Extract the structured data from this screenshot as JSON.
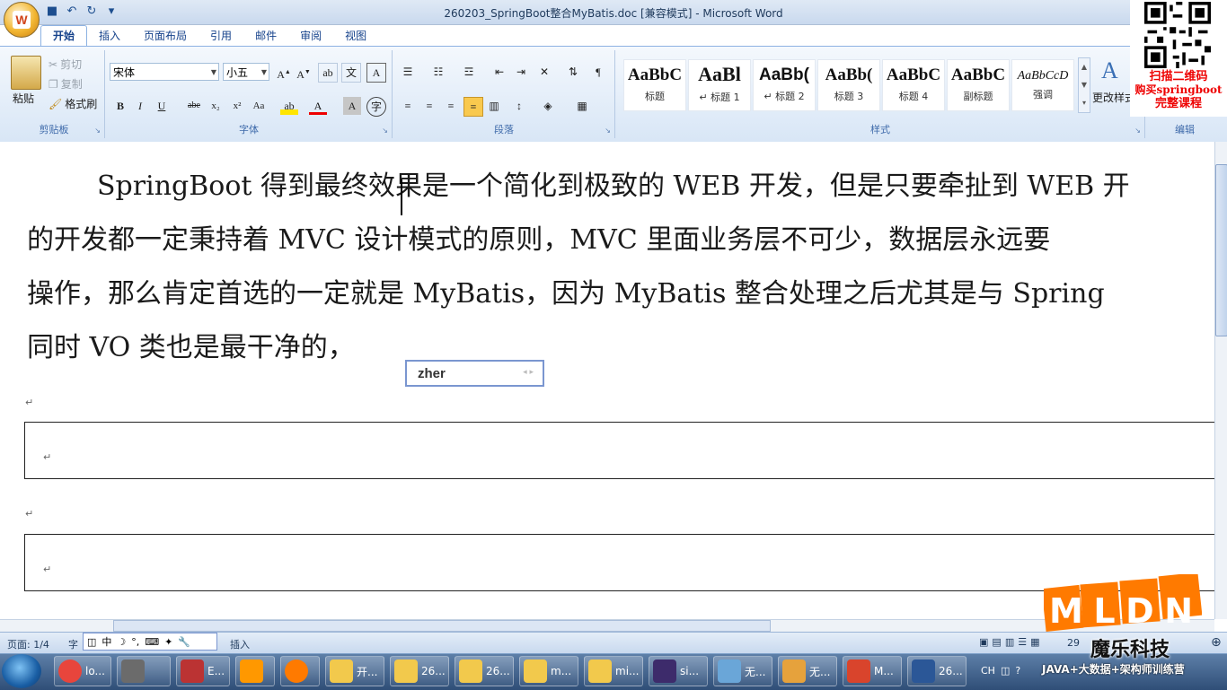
{
  "window": {
    "title": "260203_SpringBoot整合MyBatis.doc [兼容模式] - Microsoft Word"
  },
  "ribbon": {
    "tabs": [
      "开始",
      "插入",
      "页面布局",
      "引用",
      "邮件",
      "审阅",
      "视图"
    ],
    "clipboard": {
      "paste": "粘贴",
      "cut": "剪切",
      "copy": "复制",
      "format_painter": "格式刷",
      "group_label": "剪贴板"
    },
    "font": {
      "font_name": "宋体",
      "font_size": "小五",
      "group_label": "字体"
    },
    "paragraph": {
      "group_label": "段落"
    },
    "styles": {
      "items": [
        {
          "sample": "AaBbC",
          "name": "标题"
        },
        {
          "sample": "AaBl",
          "name": "↵ 标题 1"
        },
        {
          "sample": "AaBb(",
          "name": "↵ 标题 2"
        },
        {
          "sample": "AaBb(",
          "name": "标题 3"
        },
        {
          "sample": "AaBbC",
          "name": "标题 4"
        },
        {
          "sample": "AaBbC",
          "name": "副标题"
        },
        {
          "sample": "AaBbCcD",
          "name": "强调"
        }
      ],
      "change_styles": "更改样式",
      "group_label": "样式"
    },
    "editing": {
      "group_label": "编辑"
    }
  },
  "promo": {
    "line1": "扫描二维码",
    "line2": "购买springboot",
    "line3": "完整课程"
  },
  "document": {
    "lines": [
      "SpringBoot 得到最终效果是一个简化到极致的 WEB 开发，但是只要牵扯到 WEB 开",
      "的开发都一定秉持着 MVC 设计模式的原则，MVC 里面业务层不可少，数据层永远要",
      "操作，那么肯定首选的一定就是 MyBatis，因为 MyBatis 整合处理之后尤其是与 Spring",
      "同时 VO 类也是最干净的，"
    ],
    "paragraph_mark": "↵",
    "ime_composition": "zher"
  },
  "statusbar": {
    "page": "页面: 1/4",
    "word_count_partial": "字",
    "ime_toolbar": [
      "中",
      "插入"
    ],
    "insert_mode": "插入",
    "zoom_partial": "29"
  },
  "watermark": {
    "logo": "MLDN",
    "company": "魔乐科技",
    "tagline": "JAVA+大数据+架构师训练营"
  },
  "taskbar": {
    "items": [
      {
        "label": "lo...",
        "icon": "chrome-icon",
        "color": "#e8453c"
      },
      {
        "label": "",
        "icon": "app-icon",
        "color": "#6b6b6b"
      },
      {
        "label": "E...",
        "icon": "app-icon",
        "color": "#b33"
      },
      {
        "label": "",
        "icon": "sublime-icon",
        "color": "#ff9800"
      },
      {
        "label": "",
        "icon": "firefox-icon",
        "color": "#ff7a00"
      },
      {
        "label": "开...",
        "icon": "folder-icon",
        "color": "#f2c94c"
      },
      {
        "label": "26...",
        "icon": "folder-icon",
        "color": "#f2c94c"
      },
      {
        "label": "26...",
        "icon": "folder-icon",
        "color": "#f2c94c"
      },
      {
        "label": "m...",
        "icon": "folder-icon",
        "color": "#f2c94c"
      },
      {
        "label": "mi...",
        "icon": "folder-icon",
        "color": "#f2c94c"
      },
      {
        "label": "si...",
        "icon": "eclipse-icon",
        "color": "#3d2b6b"
      },
      {
        "label": "无...",
        "icon": "app-icon",
        "color": "#6aa6d8"
      },
      {
        "label": "无...",
        "icon": "paint-icon",
        "color": "#e6a23c"
      },
      {
        "label": "M...",
        "icon": "app-icon",
        "color": "#d9442c"
      },
      {
        "label": "26...",
        "icon": "word-icon",
        "color": "#2b5797"
      }
    ],
    "tray_lang": "CH"
  }
}
